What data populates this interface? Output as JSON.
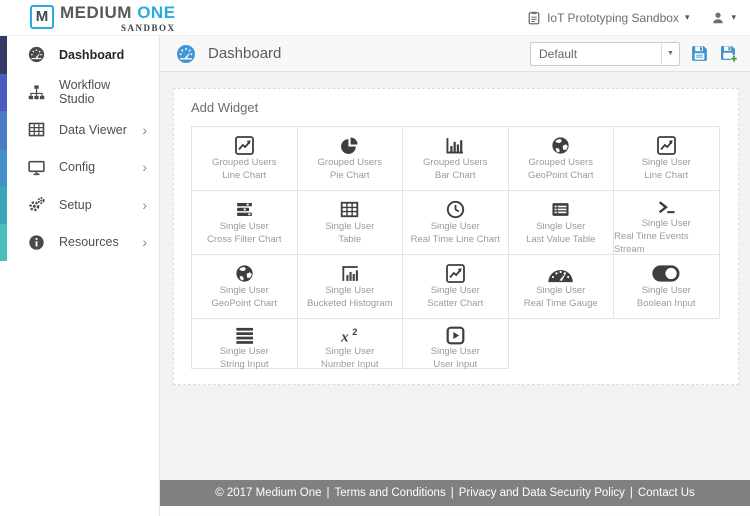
{
  "brand": {
    "mark": "M",
    "name_primary": "MEDIUM",
    "name_accent": "ONE",
    "subtitle": "SANDBOX"
  },
  "topbar": {
    "sandbox_selector": "IoT Prototyping Sandbox"
  },
  "sidebar": {
    "strip_colors": [
      "#323a66",
      "#4a5cc0",
      "#4a7dc4",
      "#4390c8",
      "#3ba6bb",
      "#46bfbd"
    ],
    "items": [
      {
        "id": "dashboard",
        "icon": "gauge",
        "label": "Dashboard",
        "active": true,
        "has_submenu": false
      },
      {
        "id": "workflow-studio",
        "icon": "sitemap",
        "label": "Workflow Studio",
        "active": false,
        "has_submenu": false
      },
      {
        "id": "data-viewer",
        "icon": "table",
        "label": "Data Viewer",
        "active": false,
        "has_submenu": true
      },
      {
        "id": "config",
        "icon": "desktop",
        "label": "Config",
        "active": false,
        "has_submenu": true
      },
      {
        "id": "setup",
        "icon": "gears",
        "label": "Setup",
        "active": false,
        "has_submenu": true
      },
      {
        "id": "resources",
        "icon": "info",
        "label": "Resources",
        "active": false,
        "has_submenu": true
      }
    ]
  },
  "main_header": {
    "title": "Dashboard",
    "dashboard_select_value": "Default"
  },
  "panel": {
    "title": "Add Widget",
    "widgets": [
      {
        "icon": "line-chart",
        "line1": "Grouped Users",
        "line2": "Line Chart"
      },
      {
        "icon": "pie-chart",
        "line1": "Grouped Users",
        "line2": "Pie Chart"
      },
      {
        "icon": "bar-chart",
        "line1": "Grouped Users",
        "line2": "Bar Chart"
      },
      {
        "icon": "globe",
        "line1": "Grouped Users",
        "line2": "GeoPoint Chart"
      },
      {
        "icon": "line-chart",
        "line1": "Single User",
        "line2": "Line Chart"
      },
      {
        "icon": "sliders",
        "line1": "Single User",
        "line2": "Cross Filter Chart"
      },
      {
        "icon": "table",
        "line1": "Single User",
        "line2": "Table"
      },
      {
        "icon": "clock",
        "line1": "Single User",
        "line2": "Real Time Line Chart"
      },
      {
        "icon": "list-table",
        "line1": "Single User",
        "line2": "Last Value Table"
      },
      {
        "icon": "terminal",
        "line1": "Single User",
        "line2": "Real Time Events Stream"
      },
      {
        "icon": "globe",
        "line1": "Single User",
        "line2": "GeoPoint Chart"
      },
      {
        "icon": "histogram",
        "line1": "Single User",
        "line2": "Bucketed Histogram"
      },
      {
        "icon": "scatter",
        "line1": "Single User",
        "line2": "Scatter Chart"
      },
      {
        "icon": "gauge-semi",
        "line1": "Single User",
        "line2": "Real Time Gauge"
      },
      {
        "icon": "toggle",
        "line1": "Single User",
        "line2": "Boolean Input"
      },
      {
        "icon": "text-lines",
        "line1": "Single User",
        "line2": "String Input"
      },
      {
        "icon": "x-squared",
        "line1": "Single User",
        "line2": "Number Input"
      },
      {
        "icon": "play-square",
        "line1": "Single User",
        "line2": "User Input"
      }
    ]
  },
  "footer": {
    "copyright": "© 2017 Medium One",
    "links": [
      "Terms and Conditions",
      "Privacy and Data Security Policy",
      "Contact Us"
    ]
  },
  "colors": {
    "accent_blue": "#29abe2",
    "header_icon_blue": "#4496d2",
    "save_plus_green": "#3da639",
    "footer_bg": "#808080"
  }
}
